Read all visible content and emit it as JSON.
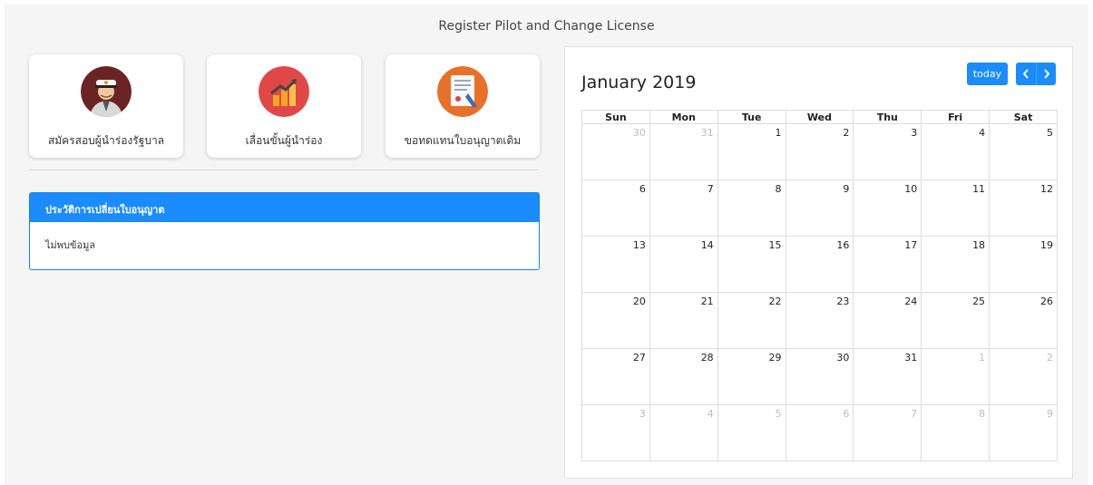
{
  "page": {
    "title": "Register Pilot and Change License"
  },
  "cards": [
    {
      "label": "สมัครสอบผู้นำร่องรัฐบาล",
      "icon": "pilot-avatar-icon"
    },
    {
      "label": "เลื่อนขั้นผู้นำร่อง",
      "icon": "promotion-chart-icon"
    },
    {
      "label": "ขอทดแทนใบอนุญาตเดิม",
      "icon": "license-document-icon"
    }
  ],
  "history": {
    "header": "ประวัติการเปลี่ยนใบอนุญาต",
    "empty_text": "ไม่พบข้อมูล"
  },
  "calendar": {
    "title": "January 2019",
    "today_label": "today",
    "weekdays": [
      "Sun",
      "Mon",
      "Tue",
      "Wed",
      "Thu",
      "Fri",
      "Sat"
    ],
    "weeks": [
      [
        {
          "d": "30",
          "o": true
        },
        {
          "d": "31",
          "o": true
        },
        {
          "d": "1"
        },
        {
          "d": "2"
        },
        {
          "d": "3"
        },
        {
          "d": "4"
        },
        {
          "d": "5"
        }
      ],
      [
        {
          "d": "6"
        },
        {
          "d": "7"
        },
        {
          "d": "8"
        },
        {
          "d": "9"
        },
        {
          "d": "10"
        },
        {
          "d": "11"
        },
        {
          "d": "12"
        }
      ],
      [
        {
          "d": "13"
        },
        {
          "d": "14"
        },
        {
          "d": "15"
        },
        {
          "d": "16"
        },
        {
          "d": "17"
        },
        {
          "d": "18"
        },
        {
          "d": "19"
        }
      ],
      [
        {
          "d": "20"
        },
        {
          "d": "21"
        },
        {
          "d": "22"
        },
        {
          "d": "23"
        },
        {
          "d": "24"
        },
        {
          "d": "25"
        },
        {
          "d": "26"
        }
      ],
      [
        {
          "d": "27"
        },
        {
          "d": "28"
        },
        {
          "d": "29"
        },
        {
          "d": "30"
        },
        {
          "d": "31"
        },
        {
          "d": "1",
          "o": true
        },
        {
          "d": "2",
          "o": true
        }
      ],
      [
        {
          "d": "3",
          "o": true
        },
        {
          "d": "4",
          "o": true
        },
        {
          "d": "5",
          "o": true
        },
        {
          "d": "6",
          "o": true
        },
        {
          "d": "7",
          "o": true
        },
        {
          "d": "8",
          "o": true
        },
        {
          "d": "9",
          "o": true
        }
      ]
    ]
  },
  "colors": {
    "accent": "#1a8cff",
    "muted_day": "#bdbdbd",
    "background": "#f5f5f5"
  }
}
